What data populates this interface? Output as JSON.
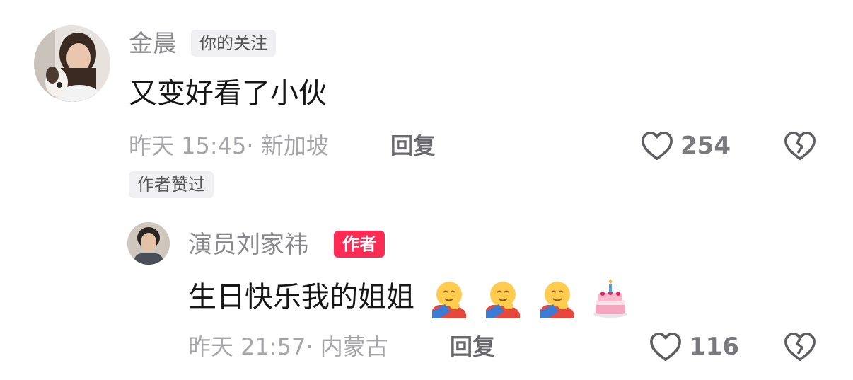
{
  "comment": {
    "author": "金晨",
    "badge": "你的关注",
    "text": "又变好看了小伙",
    "time_location": "昨天 15:45· 新加坡",
    "reply_label": "回复",
    "likes": "254",
    "author_liked_label": "作者赞过",
    "avatar_icon": "woman-with-dog-avatar",
    "reply_comment": {
      "author": "演员刘家祎",
      "badge": "作者",
      "text": "生日快乐我的姐姐",
      "emojis": [
        "hugging-face-emoji",
        "hugging-face-emoji",
        "hugging-face-emoji",
        "birthday-cake-emoji"
      ],
      "time_location": "昨天 21:57· 内蒙古",
      "reply_label": "回复",
      "likes": "116",
      "avatar_icon": "man-portrait-avatar"
    }
  },
  "colors": {
    "author_badge": "#fe2c55",
    "meta_text": "#a6a6aa",
    "icon_stroke": "#5f5f63"
  }
}
